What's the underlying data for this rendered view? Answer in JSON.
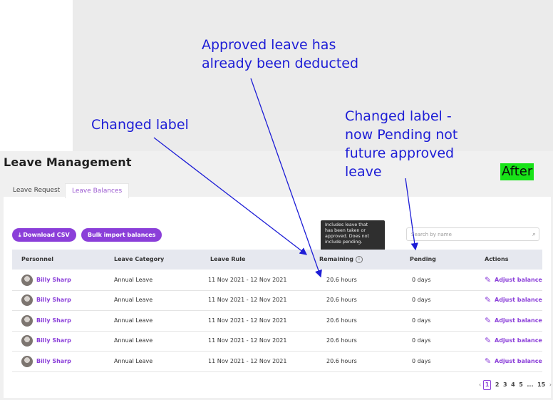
{
  "annotations": {
    "approved_line1": "Approved leave has",
    "approved_line2": "already been deducted",
    "changed_label": "Changed label",
    "pending_line1": "Changed label -",
    "pending_line2": "now Pending not",
    "pending_line3": "future approved",
    "pending_line4": "leave",
    "after": "After",
    "annotation_color": "#1d1dd6",
    "after_bg": "#18e318"
  },
  "page": {
    "title": "Leave Management",
    "accent": "#8b3fd9"
  },
  "tabs": [
    {
      "label": "Leave Request",
      "active": false
    },
    {
      "label": "Leave Balances",
      "active": true
    }
  ],
  "toolbar": {
    "download_label": "Download CSV",
    "download_icon": "download-icon",
    "import_label": "Bulk import balances",
    "search_placeholder": "Search by name",
    "search_icon": "search-icon"
  },
  "tooltip": {
    "line1": "Includes leave that",
    "line2": "has been taken or",
    "line3": "approved. Does not",
    "line4": "include pending."
  },
  "table": {
    "headers": [
      "Personnel",
      "Leave Category",
      "Leave Rule",
      "Remaining",
      "Pending",
      "Actions"
    ],
    "rows": [
      {
        "name": "Billy Sharp",
        "category": "Annual Leave",
        "rule": "11 Nov 2021 - 12 Nov 2021",
        "remaining": "20.6 hours",
        "pending": "0  days",
        "action": "Adjust balance"
      },
      {
        "name": "Billy Sharp",
        "category": "Annual Leave",
        "rule": "11 Nov 2021 - 12 Nov 2021",
        "remaining": "20.6 hours",
        "pending": "0  days",
        "action": "Adjust balance"
      },
      {
        "name": "Billy Sharp",
        "category": "Annual Leave",
        "rule": "11 Nov 2021 - 12 Nov 2021",
        "remaining": "20.6 hours",
        "pending": "0  days",
        "action": "Adjust balance"
      },
      {
        "name": "Billy Sharp",
        "category": "Annual Leave",
        "rule": "11 Nov 2021 - 12 Nov 2021",
        "remaining": "20.6 hours",
        "pending": "0  days",
        "action": "Adjust balance"
      },
      {
        "name": "Billy Sharp",
        "category": "Annual Leave",
        "rule": "11 Nov 2021 - 12 Nov 2021",
        "remaining": "20.6 hours",
        "pending": "0  days",
        "action": "Adjust balance"
      }
    ]
  },
  "pagination": {
    "prev": "‹",
    "pages": [
      "1",
      "2",
      "3",
      "4",
      "5",
      "...",
      "15"
    ],
    "next": "›",
    "current": "1"
  }
}
